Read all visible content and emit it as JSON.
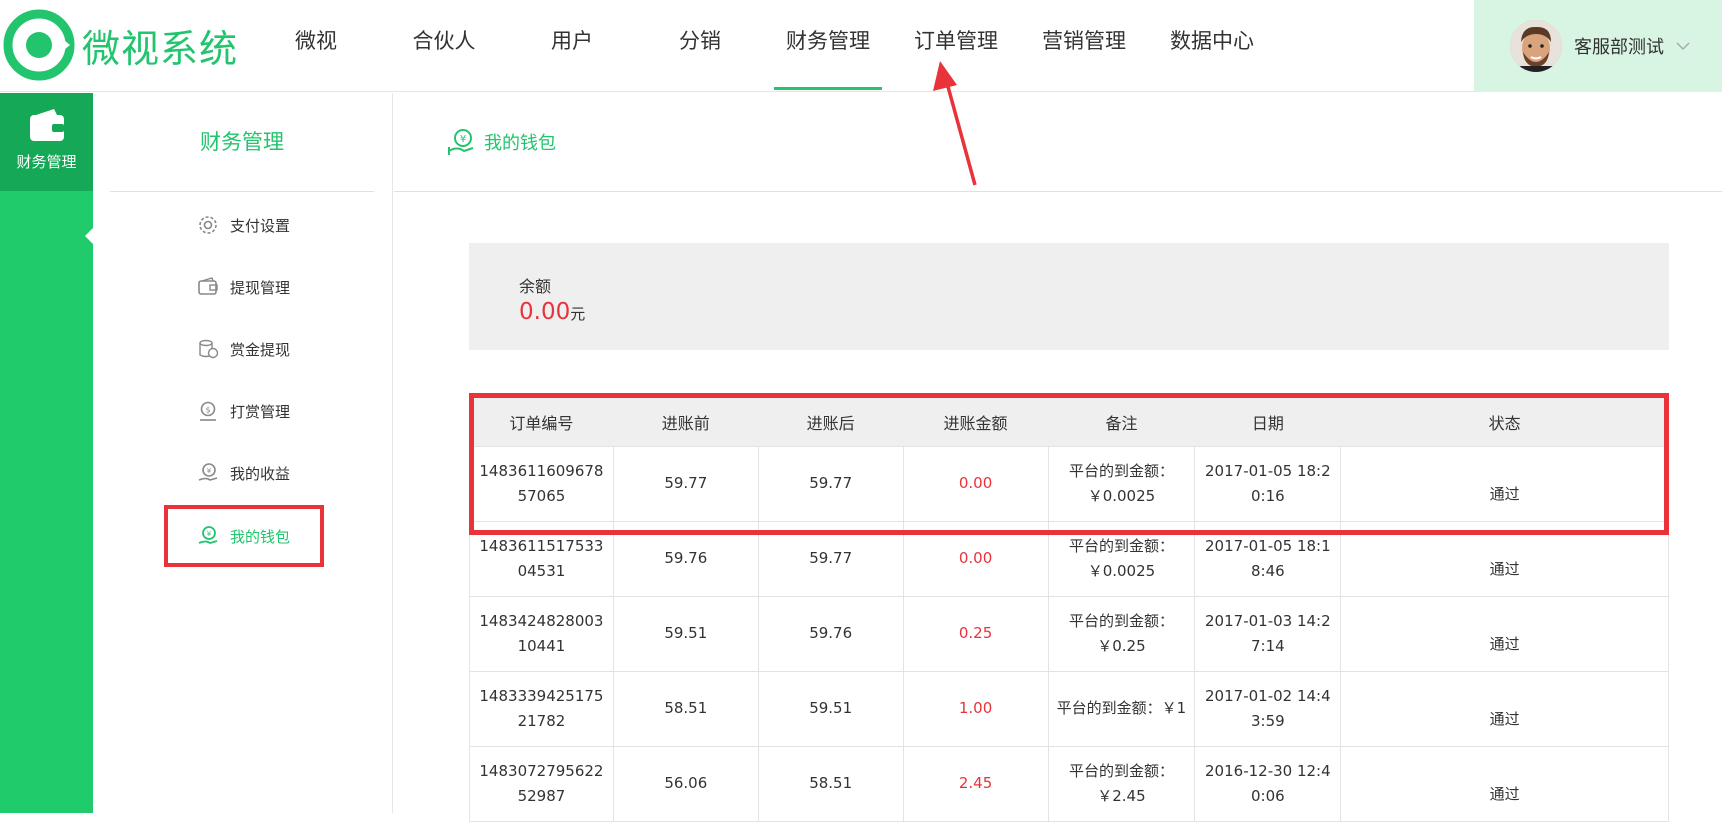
{
  "app": {
    "logo_text": "微视系统"
  },
  "nav": [
    {
      "label": "微视"
    },
    {
      "label": "合伙人"
    },
    {
      "label": "用户"
    },
    {
      "label": "分销"
    },
    {
      "label": "财务管理",
      "active": true
    },
    {
      "label": "订单管理"
    },
    {
      "label": "营销管理"
    },
    {
      "label": "数据中心"
    }
  ],
  "user": {
    "name": "客服部测试"
  },
  "rail": {
    "label": "财务管理"
  },
  "sidebar": {
    "title": "财务管理",
    "items": [
      {
        "label": "支付设置",
        "icon": "gear-icon"
      },
      {
        "label": "提现管理",
        "icon": "wallet-icon"
      },
      {
        "label": "赏金提现",
        "icon": "coins-icon"
      },
      {
        "label": "打赏管理",
        "icon": "reward-icon"
      },
      {
        "label": "我的收益",
        "icon": "income-icon"
      },
      {
        "label": "我的钱包",
        "icon": "wallet-hand-icon",
        "active": true
      }
    ]
  },
  "main": {
    "title": "我的钱包",
    "balance_label": "余额",
    "balance_value": "0.00",
    "balance_unit": "元"
  },
  "table": {
    "headers": [
      "订单编号",
      "进账前",
      "进账后",
      "进账金额",
      "备注",
      "日期",
      "状态"
    ],
    "rows": [
      [
        "148361160967857065",
        "59.77",
        "59.77",
        "0.00",
        "平台的到金额：￥0.0025",
        "2017-01-05 18:20:16",
        "通过"
      ],
      [
        "148361151753304531",
        "59.76",
        "59.77",
        "0.00",
        "平台的到金额：￥0.0025",
        "2017-01-05 18:18:46",
        "通过"
      ],
      [
        "148342482800310441",
        "59.51",
        "59.76",
        "0.25",
        "平台的到金额：￥0.25",
        "2017-01-03 14:27:14",
        "通过"
      ],
      [
        "148333942517521782",
        "58.51",
        "59.51",
        "1.00",
        "平台的到金额：￥1",
        "2017-01-02 14:43:59",
        "通过"
      ],
      [
        "148307279562252987",
        "56.06",
        "58.51",
        "2.45",
        "平台的到金额：￥2.45",
        "2016-12-30 12:40:06",
        "通过"
      ]
    ]
  },
  "colors": {
    "brand": "#22c56e",
    "rail": "#1fcb6b",
    "annotation": "#e8333a"
  }
}
